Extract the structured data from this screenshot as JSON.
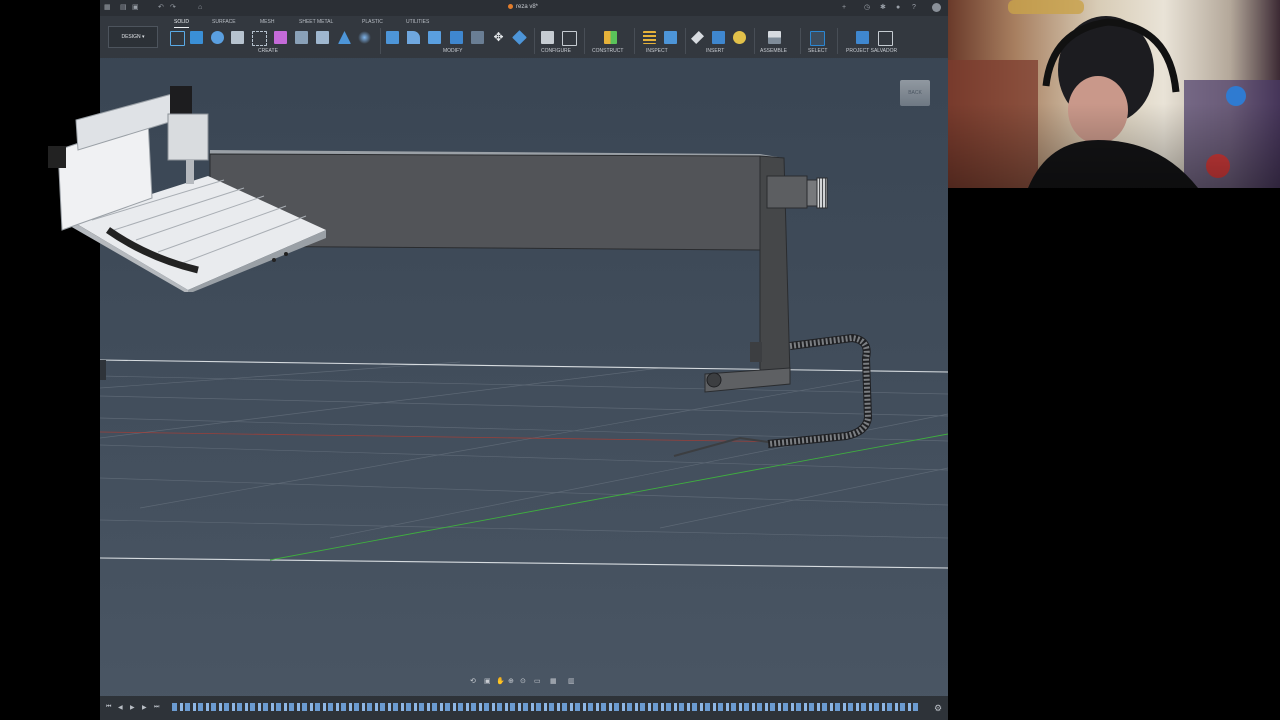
{
  "window": {
    "doc_title": "reza v8*",
    "right_icons": [
      "add-tab-icon",
      "history-icon",
      "extensions-icon",
      "notifications-icon",
      "help-icon",
      "account-avatar-icon"
    ]
  },
  "workspace": {
    "label": "DESIGN"
  },
  "tabs": [
    {
      "label": "SOLID",
      "active": true
    },
    {
      "label": "SURFACE",
      "active": false
    },
    {
      "label": "MESH",
      "active": false
    },
    {
      "label": "SHEET METAL",
      "active": false
    },
    {
      "label": "PLASTIC",
      "active": false
    },
    {
      "label": "UTILITIES",
      "active": false
    }
  ],
  "groups": {
    "create": "CREATE",
    "modify": "MODIFY",
    "configure": "CONFIGURE",
    "construct": "CONSTRUCT",
    "inspect": "INSPECT",
    "insert": "INSERT",
    "assemble": "ASSEMBLE",
    "select": "SELECT",
    "project_salvador": "PROJECT SALVADOR"
  },
  "viewcube": {
    "face_label": "BACK"
  },
  "colors": {
    "accent": "#2b87d3",
    "axis_x": "#c0392b",
    "axis_y": "#3fae3f",
    "timeline_feature": "#6b9bd1"
  }
}
